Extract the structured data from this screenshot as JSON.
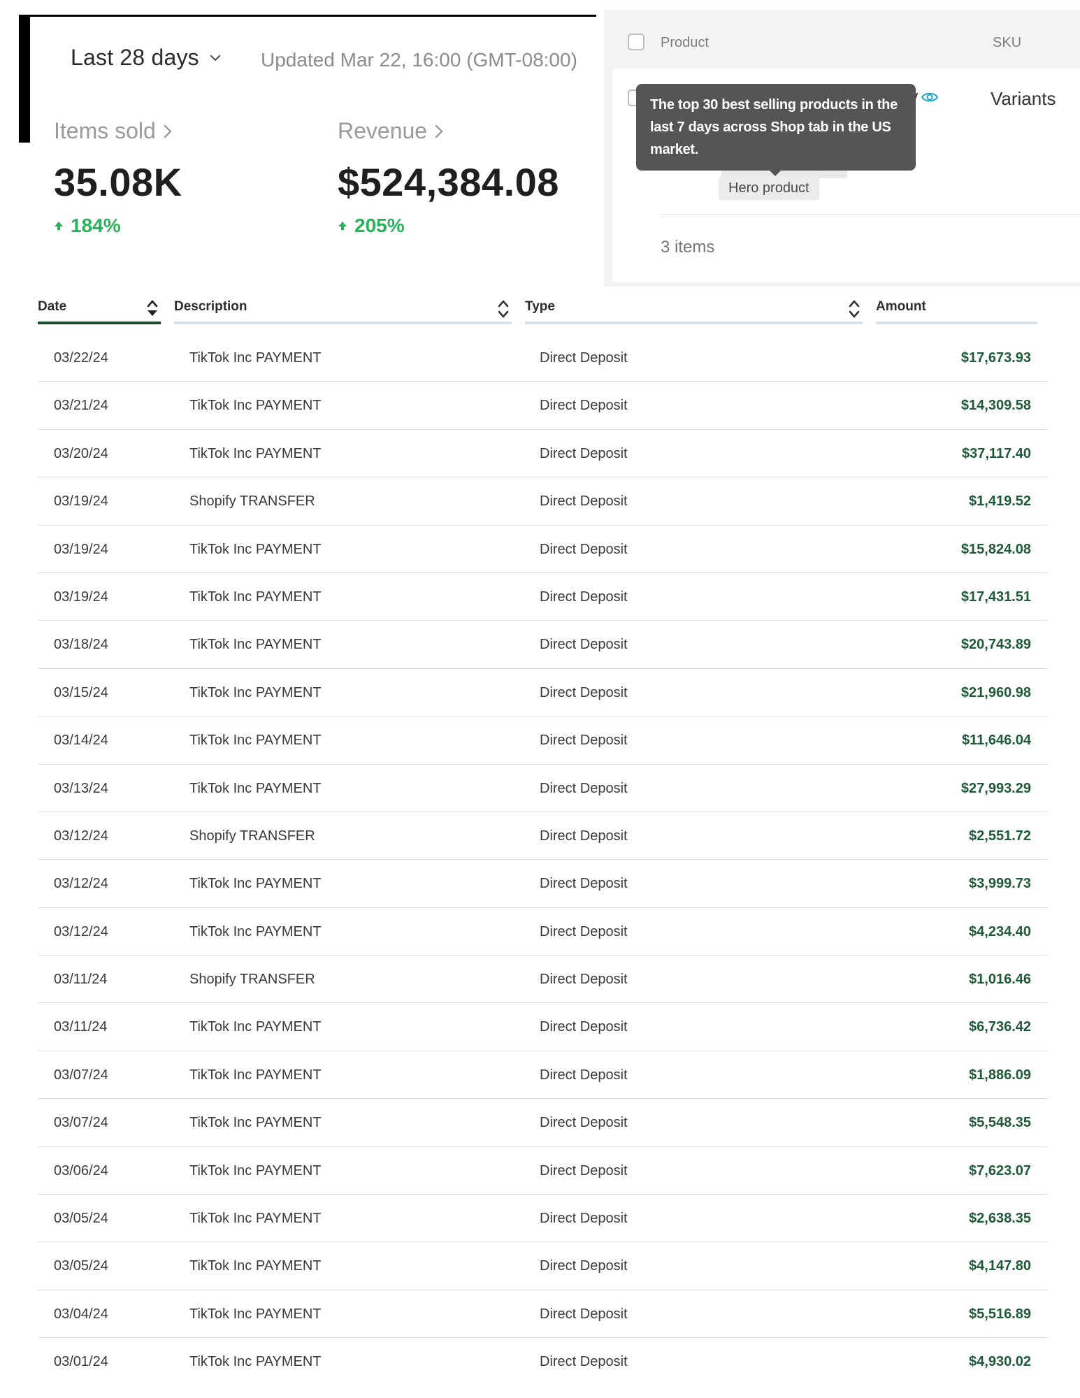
{
  "analytics": {
    "range_label": "Last 28 days",
    "updated": "Updated Mar 22, 16:00 (GMT-08:00)",
    "items_sold": {
      "label": "Items sold",
      "value": "35.08K",
      "change": "184%"
    },
    "revenue": {
      "label": "Revenue",
      "value": "$524,384.08",
      "change": "205%"
    },
    "accent_color": "#27b35a"
  },
  "products": {
    "columns": {
      "product": "Product",
      "sku": "SKU"
    },
    "row": {
      "name_tail": "ly",
      "sku": "Variants"
    },
    "tooltip": "The top 30 best selling products in the last 7 days across Shop tab in the US market.",
    "badge": "Hero product",
    "items_count": "3 items"
  },
  "transactions": {
    "columns": {
      "date": "Date",
      "description": "Description",
      "type": "Type",
      "amount": "Amount"
    },
    "amount_color": "#1e5a38",
    "rows": [
      {
        "date": "03/22/24",
        "description": "TikTok Inc PAYMENT",
        "type": "Direct Deposit",
        "amount": "$17,673.93"
      },
      {
        "date": "03/21/24",
        "description": "TikTok Inc PAYMENT",
        "type": "Direct Deposit",
        "amount": "$14,309.58"
      },
      {
        "date": "03/20/24",
        "description": "TikTok Inc PAYMENT",
        "type": "Direct Deposit",
        "amount": "$37,117.40"
      },
      {
        "date": "03/19/24",
        "description": "Shopify TRANSFER",
        "type": "Direct Deposit",
        "amount": "$1,419.52"
      },
      {
        "date": "03/19/24",
        "description": "TikTok Inc PAYMENT",
        "type": "Direct Deposit",
        "amount": "$15,824.08"
      },
      {
        "date": "03/19/24",
        "description": "TikTok Inc PAYMENT",
        "type": "Direct Deposit",
        "amount": "$17,431.51"
      },
      {
        "date": "03/18/24",
        "description": "TikTok Inc PAYMENT",
        "type": "Direct Deposit",
        "amount": "$20,743.89"
      },
      {
        "date": "03/15/24",
        "description": "TikTok Inc PAYMENT",
        "type": "Direct Deposit",
        "amount": "$21,960.98"
      },
      {
        "date": "03/14/24",
        "description": "TikTok Inc PAYMENT",
        "type": "Direct Deposit",
        "amount": "$11,646.04"
      },
      {
        "date": "03/13/24",
        "description": "TikTok Inc PAYMENT",
        "type": "Direct Deposit",
        "amount": "$27,993.29"
      },
      {
        "date": "03/12/24",
        "description": "Shopify TRANSFER",
        "type": "Direct Deposit",
        "amount": "$2,551.72"
      },
      {
        "date": "03/12/24",
        "description": "TikTok Inc PAYMENT",
        "type": "Direct Deposit",
        "amount": "$3,999.73"
      },
      {
        "date": "03/12/24",
        "description": "TikTok Inc PAYMENT",
        "type": "Direct Deposit",
        "amount": "$4,234.40"
      },
      {
        "date": "03/11/24",
        "description": "Shopify TRANSFER",
        "type": "Direct Deposit",
        "amount": "$1,016.46"
      },
      {
        "date": "03/11/24",
        "description": "TikTok Inc PAYMENT",
        "type": "Direct Deposit",
        "amount": "$6,736.42"
      },
      {
        "date": "03/07/24",
        "description": "TikTok Inc PAYMENT",
        "type": "Direct Deposit",
        "amount": "$1,886.09"
      },
      {
        "date": "03/07/24",
        "description": "TikTok Inc PAYMENT",
        "type": "Direct Deposit",
        "amount": "$5,548.35"
      },
      {
        "date": "03/06/24",
        "description": "TikTok Inc PAYMENT",
        "type": "Direct Deposit",
        "amount": "$7,623.07"
      },
      {
        "date": "03/05/24",
        "description": "TikTok Inc PAYMENT",
        "type": "Direct Deposit",
        "amount": "$2,638.35"
      },
      {
        "date": "03/05/24",
        "description": "TikTok Inc PAYMENT",
        "type": "Direct Deposit",
        "amount": "$4,147.80"
      },
      {
        "date": "03/04/24",
        "description": "TikTok Inc PAYMENT",
        "type": "Direct Deposit",
        "amount": "$5,516.89"
      },
      {
        "date": "03/01/24",
        "description": "TikTok Inc PAYMENT",
        "type": "Direct Deposit",
        "amount": "$4,930.02"
      }
    ]
  }
}
